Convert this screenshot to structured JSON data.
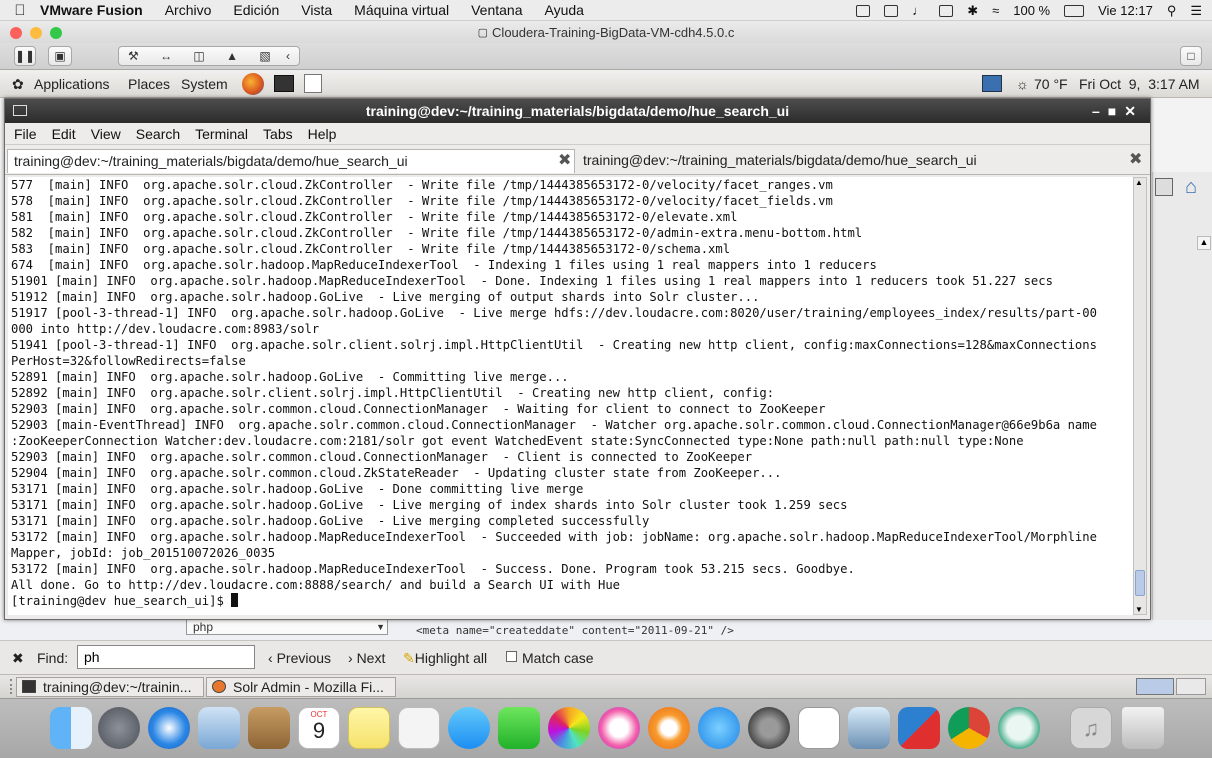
{
  "mac_menubar": {
    "app_name": "VMware Fusion",
    "menus": [
      "Archivo",
      "Edición",
      "Vista",
      "Máquina virtual",
      "Ventana",
      "Ayuda"
    ],
    "battery": "100 %",
    "clock": "Vie 12:17"
  },
  "vmware": {
    "window_title": "Cloudera-Training-BigData-VM-cdh4.5.0.c"
  },
  "gnome_panel": {
    "menus": [
      "Applications",
      "Places",
      "System"
    ],
    "weather": "70 °F",
    "datetime": "Fri Oct  9,  3:17 AM"
  },
  "terminal": {
    "title": "training@dev:~/training_materials/bigdata/demo/hue_search_ui",
    "menus": [
      "File",
      "Edit",
      "View",
      "Search",
      "Terminal",
      "Tabs",
      "Help"
    ],
    "tabs": [
      {
        "label": "training@dev:~/training_materials/bigdata/demo/hue_search_ui"
      },
      {
        "label": "training@dev:~/training_materials/bigdata/demo/hue_search_ui"
      }
    ],
    "lines": [
      "577  [main] INFO  org.apache.solr.cloud.ZkController  - Write file /tmp/1444385653172-0/velocity/facet_ranges.vm",
      "578  [main] INFO  org.apache.solr.cloud.ZkController  - Write file /tmp/1444385653172-0/velocity/facet_fields.vm",
      "581  [main] INFO  org.apache.solr.cloud.ZkController  - Write file /tmp/1444385653172-0/elevate.xml",
      "582  [main] INFO  org.apache.solr.cloud.ZkController  - Write file /tmp/1444385653172-0/admin-extra.menu-bottom.html",
      "583  [main] INFO  org.apache.solr.cloud.ZkController  - Write file /tmp/1444385653172-0/schema.xml",
      "674  [main] INFO  org.apache.solr.hadoop.MapReduceIndexerTool  - Indexing 1 files using 1 real mappers into 1 reducers",
      "51901 [main] INFO  org.apache.solr.hadoop.MapReduceIndexerTool  - Done. Indexing 1 files using 1 real mappers into 1 reducers took 51.227 secs",
      "51912 [main] INFO  org.apache.solr.hadoop.GoLive  - Live merging of output shards into Solr cluster...",
      "51917 [pool-3-thread-1] INFO  org.apache.solr.hadoop.GoLive  - Live merge hdfs://dev.loudacre.com:8020/user/training/employees_index/results/part-00",
      "000 into http://dev.loudacre.com:8983/solr",
      "51941 [pool-3-thread-1] INFO  org.apache.solr.client.solrj.impl.HttpClientUtil  - Creating new http client, config:maxConnections=128&maxConnections",
      "PerHost=32&followRedirects=false",
      "52891 [main] INFO  org.apache.solr.hadoop.GoLive  - Committing live merge...",
      "52892 [main] INFO  org.apache.solr.client.solrj.impl.HttpClientUtil  - Creating new http client, config:",
      "52903 [main] INFO  org.apache.solr.common.cloud.ConnectionManager  - Waiting for client to connect to ZooKeeper",
      "52903 [main-EventThread] INFO  org.apache.solr.common.cloud.ConnectionManager  - Watcher org.apache.solr.common.cloud.ConnectionManager@66e9b6a name",
      ":ZooKeeperConnection Watcher:dev.loudacre.com:2181/solr got event WatchedEvent state:SyncConnected type:None path:null path:null type:None",
      "52903 [main] INFO  org.apache.solr.common.cloud.ConnectionManager  - Client is connected to ZooKeeper",
      "52904 [main] INFO  org.apache.solr.common.cloud.ZkStateReader  - Updating cluster state from ZooKeeper...",
      "53171 [main] INFO  org.apache.solr.hadoop.GoLive  - Done committing live merge",
      "53171 [main] INFO  org.apache.solr.hadoop.GoLive  - Live merging of index shards into Solr cluster took 1.259 secs",
      "53171 [main] INFO  org.apache.solr.hadoop.GoLive  - Live merging completed successfully",
      "53172 [main] INFO  org.apache.solr.hadoop.MapReduceIndexerTool  - Succeeded with job: jobName: org.apache.solr.hadoop.MapReduceIndexerTool/Morphline",
      "Mapper, jobId: job_201510072026_0035",
      "53172 [main] INFO  org.apache.solr.hadoop.MapReduceIndexerTool  - Success. Done. Program took 53.215 secs. Goodbye.",
      "All done. Go to http://dev.loudacre.com:8888/search/ and build a Search UI with Hue"
    ],
    "prompt": "[training@dev hue_search_ui]$ "
  },
  "firefox": {
    "select_value": "php",
    "source_snippet": "<meta name=\"createddate\" content=\"2011-09-21\" />",
    "find": {
      "label": "Find:",
      "value": "ph",
      "previous": "Previous",
      "next": "Next",
      "highlight_all": "Highlight all",
      "match_case": "Match case"
    }
  },
  "taskbar": {
    "tasks": [
      {
        "label": "training@dev:~/trainin..."
      },
      {
        "label": "Solr Admin - Mozilla Fi..."
      }
    ]
  },
  "dock": {
    "calendar_month": "OCT",
    "calendar_day": "9",
    "icons": [
      "finder-icon",
      "launchpad-icon",
      "safari-icon",
      "mail-icon",
      "contacts-icon",
      "calendar-icon",
      "notes-icon",
      "reminders-icon",
      "messages-icon",
      "facetime-icon",
      "photos-icon",
      "itunes-icon",
      "ibooks-icon",
      "app-store-icon",
      "system-preferences-icon",
      "polar-icon",
      "preview-icon",
      "vmware-fusion-icon",
      "chrome-icon",
      "app-icon",
      "music-folder-icon",
      "trash-icon"
    ]
  },
  "colors": {
    "terminal_titlebar": "#333333",
    "terminal_bg": "#ffffff",
    "dock_bg": "#b2b2b2"
  }
}
